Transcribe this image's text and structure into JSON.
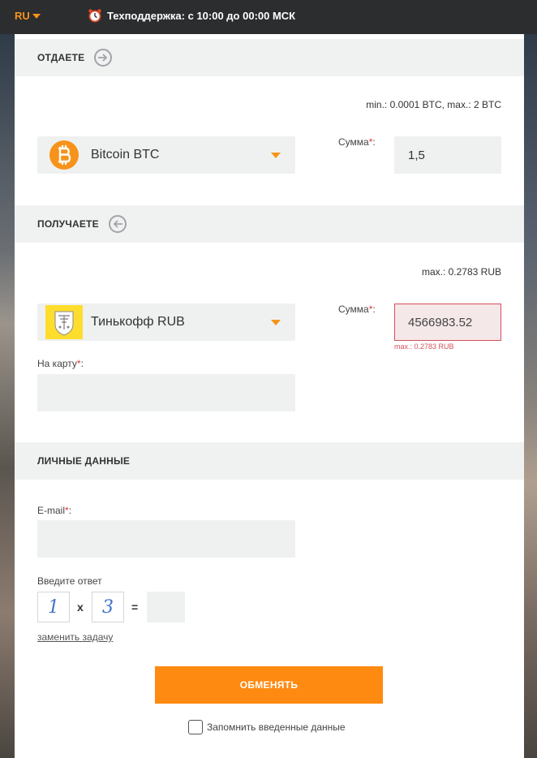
{
  "topbar": {
    "lang": "RU",
    "support": "Техподдержка: с 10:00 до 00:00 МСК"
  },
  "give": {
    "title": "ОТДАЕТЕ",
    "limits": "min.: 0.0001 BTC, max.: 2 BTC",
    "currency": "Bitcoin BTC",
    "sum_label": "Сумма",
    "sum_value": "1,5"
  },
  "receive": {
    "title": "ПОЛУЧАЕТЕ",
    "limits": "max.: 0.2783 RUB",
    "currency": "Тинькофф RUB",
    "sum_label": "Сумма",
    "sum_value": "4566983.52",
    "sum_error": "max.: 0.2783 RUB",
    "card_label": "На карту"
  },
  "personal": {
    "title": "ЛИЧНЫЕ ДАННЫЕ",
    "email_label": "E-mail",
    "captcha_label": "Введите ответ",
    "captcha_a": "1",
    "captcha_op": "x",
    "captcha_b": "3",
    "captcha_eq": "=",
    "change_task": "заменить задачу",
    "submit": "ОБМЕНЯТЬ",
    "remember": "Запомнить введенные данные"
  },
  "required_mark": "*",
  "label_colon": ":",
  "colors": {
    "accent": "#ff8a11",
    "bitcoin": "#f7931a",
    "error": "#d4505a",
    "topbar": "#2b2d2f"
  }
}
